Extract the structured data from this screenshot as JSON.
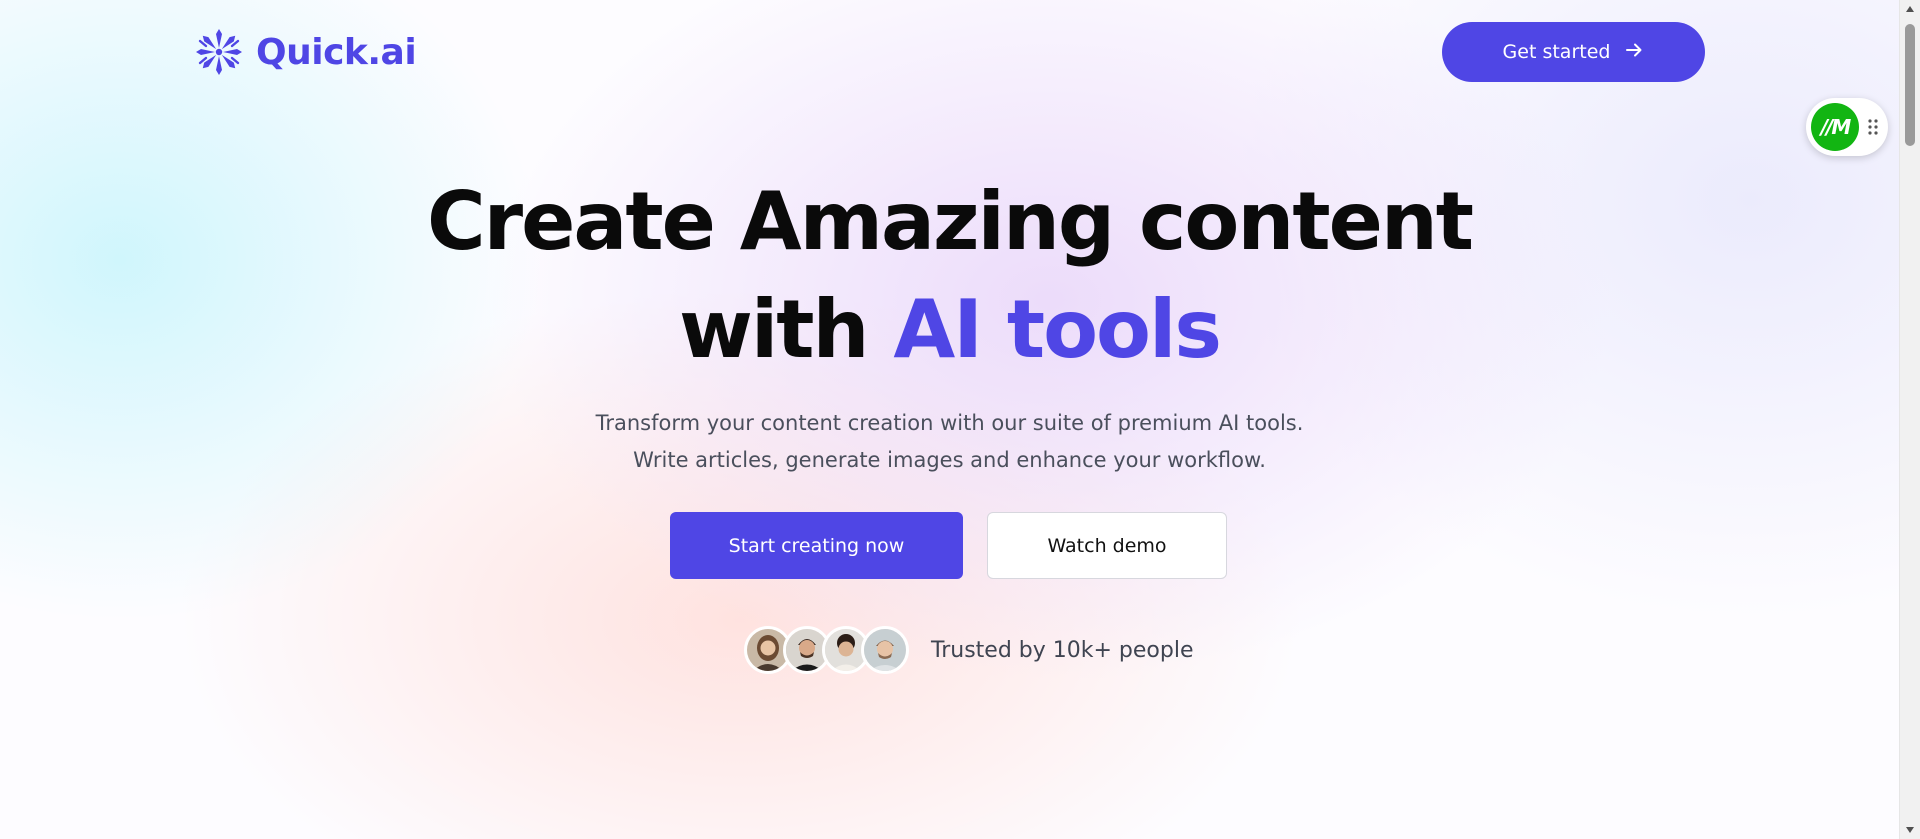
{
  "header": {
    "brand": "Quick.ai",
    "cta_label": "Get started"
  },
  "hero": {
    "title_line1": "Create Amazing content",
    "title_line2_prefix": "with ",
    "title_line2_accent": "AI tools",
    "subtitle_line1": "Transform your content creation with our suite of premium AI tools.",
    "subtitle_line2": "Write articles, generate images and enhance your workflow.",
    "primary_button": "Start creating now",
    "secondary_button": "Watch demo",
    "trusted_text": "Trusted by 10k+ people"
  },
  "extension": {
    "logo_text": "//M"
  },
  "icons": {
    "logo": "snowflake-logo-icon",
    "cta": "arrow-right-icon",
    "drag": "drag-handle-icon"
  },
  "colors": {
    "accent": "#4f46e5",
    "text_dark": "#0a0a0a",
    "text_muted": "#4a4f5c",
    "extension_green": "#12b512"
  }
}
